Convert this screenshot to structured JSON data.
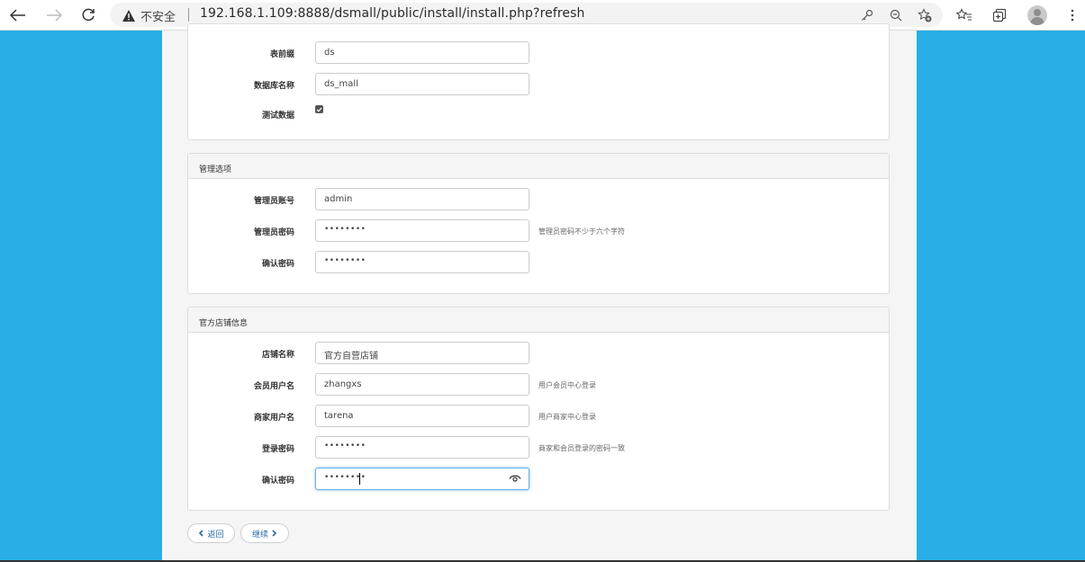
{
  "browser": {
    "security_label": "不安全",
    "url": "192.168.1.109:8888/dsmall/public/install/install.php?refresh"
  },
  "sections": {
    "database": {
      "fields": [
        {
          "label": "表前缀",
          "value": "ds"
        },
        {
          "label": "数据库名称",
          "value": "ds_mall"
        }
      ],
      "test_data_label": "测试数据",
      "test_data_checked": true
    },
    "admin": {
      "title": "管理选项",
      "fields": [
        {
          "label": "管理员账号",
          "value": "admin",
          "help": ""
        },
        {
          "label": "管理员密码",
          "value": "••••••••",
          "help": "管理员密码不少于六个字符"
        },
        {
          "label": "确认密码",
          "value": "••••••••",
          "help": ""
        }
      ]
    },
    "store": {
      "title": "官方店铺信息",
      "fields": [
        {
          "label": "店铺名称",
          "value": "官方自营店铺",
          "help": ""
        },
        {
          "label": "会员用户名",
          "value": "zhangxs",
          "help": "用户会员中心登录"
        },
        {
          "label": "商家用户名",
          "value": "tarena",
          "help": "用户商家中心登录"
        },
        {
          "label": "登录密码",
          "value": "••••••••",
          "help": "商家和会员登录的密码一致"
        },
        {
          "label": "确认密码",
          "value": "••••••••",
          "help": ""
        }
      ]
    }
  },
  "buttons": {
    "back": "返回",
    "continue": "继续"
  }
}
